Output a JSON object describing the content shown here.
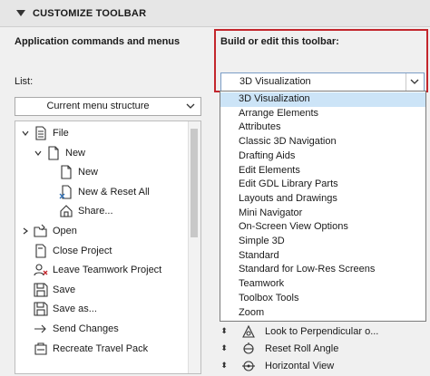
{
  "section": {
    "title": "CUSTOMIZE TOOLBAR"
  },
  "left": {
    "heading": "Application commands and menus",
    "list_label": "List:",
    "list_select": "Current menu structure",
    "tree": [
      {
        "label": "File",
        "icon": "document-list-icon",
        "arrow": "expanded"
      },
      {
        "label": "New",
        "icon": "blank-document-icon",
        "arrow": "expanded"
      },
      {
        "label": "New",
        "icon": "blank-document-icon",
        "arrow": "none"
      },
      {
        "label": "New & Reset All",
        "icon": "new-reset-icon",
        "arrow": "none"
      },
      {
        "label": "Share...",
        "icon": "share-house-icon",
        "arrow": "none"
      },
      {
        "label": "Open",
        "icon": "open-folder-icon",
        "arrow": "collapsed"
      },
      {
        "label": "Close Project",
        "icon": "close-project-icon",
        "arrow": "none"
      },
      {
        "label": "Leave Teamwork Project",
        "icon": "leave-teamwork-icon",
        "arrow": "none"
      },
      {
        "label": "Save",
        "icon": "floppy-disk-icon",
        "arrow": "none"
      },
      {
        "label": "Save as...",
        "icon": "floppy-disk-icon",
        "arrow": "none"
      },
      {
        "label": "Send Changes",
        "icon": "send-arrow-icon",
        "arrow": "none"
      },
      {
        "label": "Recreate Travel Pack",
        "icon": "travel-pack-icon",
        "arrow": "none"
      }
    ]
  },
  "right": {
    "heading": "Build or edit this toolbar:",
    "toolbar_select": "3D Visualization",
    "options": [
      "3D Visualization",
      "Arrange Elements",
      "Attributes",
      "Classic 3D Navigation",
      "Drafting Aids",
      "Edit Elements",
      "Edit GDL Library Parts",
      "Layouts and Drawings",
      "Mini Navigator",
      "On-Screen View Options",
      "Simple 3D",
      "Standard",
      "Standard for Low-Res Screens",
      "Teamwork",
      "Toolbox Tools",
      "Zoom"
    ],
    "selected_option": "3D Visualization",
    "toolbar_items": [
      {
        "label": "Look to Perpendicular o...",
        "icon": "look-perpendicular-icon"
      },
      {
        "label": "Reset Roll Angle",
        "icon": "reset-roll-icon"
      },
      {
        "label": "Horizontal View",
        "icon": "horizontal-view-icon"
      }
    ]
  },
  "colors": {
    "highlight_border": "#c3262c",
    "selection": "#cce4f7"
  }
}
